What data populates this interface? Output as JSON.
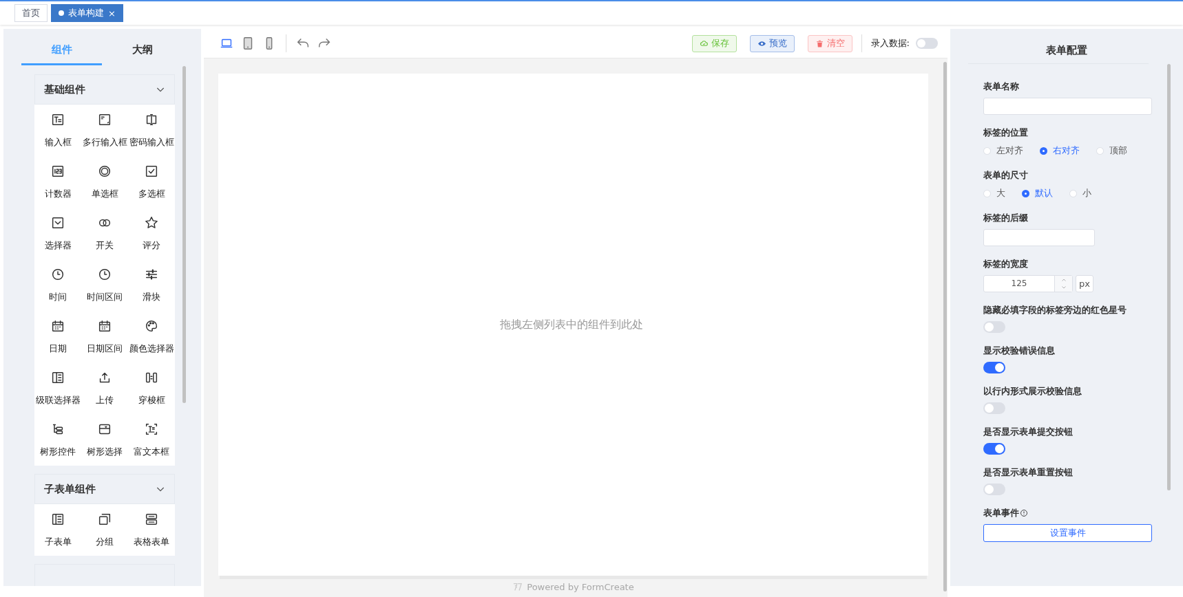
{
  "page_tabs": [
    {
      "label": "首页",
      "selected": false
    },
    {
      "label": "表单构建",
      "selected": true,
      "close": "×"
    }
  ],
  "left_panel": {
    "tabs": [
      {
        "label": "组件",
        "selected": true
      },
      {
        "label": "大纲",
        "selected": false
      }
    ],
    "groups": [
      {
        "title": "基础组件",
        "expanded": true,
        "items": [
          "输入框",
          "多行输入框",
          "密码输入框",
          "计数器",
          "单选框",
          "多选框",
          "选择器",
          "开关",
          "评分",
          "时间",
          "时间区间",
          "滑块",
          "日期",
          "日期区间",
          "颜色选择器",
          "级联选择器",
          "上传",
          "穿梭框",
          "树形控件",
          "树形选择",
          "富文本框"
        ]
      },
      {
        "title": "子表单组件",
        "expanded": true,
        "items": [
          "子表单",
          "分组",
          "表格表单"
        ]
      }
    ]
  },
  "toolbar": {
    "devices": [
      {
        "kind": "desktop",
        "selected": true
      },
      {
        "kind": "tablet",
        "selected": false
      },
      {
        "kind": "phone",
        "selected": false
      }
    ],
    "buttons": [
      {
        "kind": "save",
        "label": "保存"
      },
      {
        "kind": "preview",
        "label": "预览"
      },
      {
        "kind": "clear",
        "label": "清空"
      }
    ],
    "entry_switch": {
      "label": "录入数据:",
      "on": false
    }
  },
  "canvas": {
    "placeholder": "拖拽左侧列表中的组件到此处",
    "footer": "Powered by FormCreate"
  },
  "right_panel": {
    "title": "表单配置",
    "fields": [
      {
        "kind": "text",
        "label": "表单名称",
        "wide": true
      },
      {
        "kind": "radio",
        "label": "标签的位置",
        "options": [
          {
            "label": "左对齐",
            "selected": false
          },
          {
            "label": "右对齐",
            "selected": true
          },
          {
            "label": "顶部",
            "selected": false
          }
        ]
      },
      {
        "kind": "radio",
        "label": "表单的尺寸",
        "options": [
          {
            "label": "大",
            "selected": false
          },
          {
            "label": "默认",
            "selected": true
          },
          {
            "label": "小",
            "selected": false
          }
        ]
      },
      {
        "kind": "text",
        "label": "标签的后缀",
        "wide": false
      },
      {
        "kind": "number",
        "label": "标签的宽度",
        "value": "125",
        "unit": "px"
      },
      {
        "kind": "switch",
        "label": "隐藏必填字段的标签旁边的红色星号",
        "on": false
      },
      {
        "kind": "switch",
        "label": "显示校验错误信息",
        "on": true
      },
      {
        "kind": "switch",
        "label": "以行内形式展示校验信息",
        "on": false
      },
      {
        "kind": "switch",
        "label": "是否显示表单提交按钮",
        "on": true
      },
      {
        "kind": "switch",
        "label": "是否显示表单重置按钮",
        "on": false
      },
      {
        "kind": "button",
        "label": "表单事件",
        "button": "设置事件"
      }
    ]
  }
}
